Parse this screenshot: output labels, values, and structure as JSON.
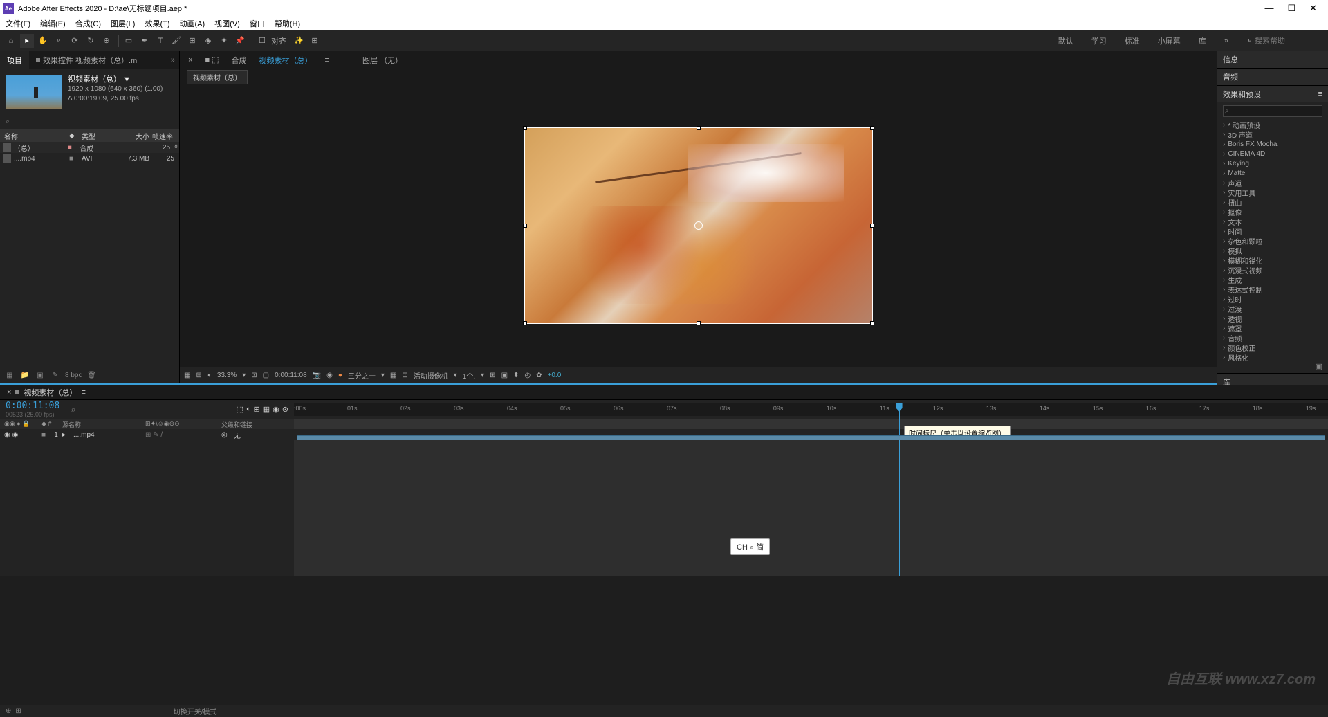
{
  "titlebar": {
    "app": "Adobe After Effects 2020",
    "path": "D:\\ae\\无标题项目.aep *"
  },
  "menu": [
    "文件(F)",
    "编辑(E)",
    "合成(C)",
    "图层(L)",
    "效果(T)",
    "动画(A)",
    "视图(V)",
    "窗口",
    "帮助(H)"
  ],
  "toolbar": {
    "snap": "对齐",
    "workspaces": [
      "默认",
      "学习",
      "标准",
      "小屏幕",
      "库"
    ],
    "search_placeholder": "搜索帮助"
  },
  "project": {
    "tab1": "项目",
    "tab2": "效果控件 视频素材（总）.m",
    "title": "视频素材（总） ▼",
    "res": "1920 x 1080 (640 x 360) (1.00)",
    "dur": "Δ 0:00:19:09, 25.00 fps",
    "search_placeholder": "⌕",
    "headers": {
      "name": "名称",
      "type": "类型",
      "size": "大小",
      "fps": "帧速率"
    },
    "rows": [
      {
        "name": "（总）",
        "type": "合成",
        "size": "",
        "fps": "25"
      },
      {
        "name": "....mp4",
        "type": "AVI",
        "size": "7.3 MB",
        "fps": "25"
      }
    ],
    "bpc": "8 bpc"
  },
  "composition": {
    "prefix": "合成",
    "name": "视频素材（总）",
    "layer_tab": "图层 （无）",
    "subtab": "视频素材（总）"
  },
  "viewer_footer": {
    "zoom": "33.3%",
    "time": "0:00:11:08",
    "res": "三分之一",
    "camera": "活动摄像机",
    "views": "1个.",
    "exposure": "+0.0"
  },
  "right_panel": {
    "info": "信息",
    "audio": "音频",
    "effects": "效果和预设",
    "search_placeholder": "⌕",
    "categories": [
      "* 动画预设",
      "3D 声道",
      "Boris FX Mocha",
      "CINEMA 4D",
      "Keying",
      "Matte",
      "声道",
      "实用工具",
      "扭曲",
      "抠像",
      "文本",
      "时间",
      "杂色和颗粒",
      "模拟",
      "模糊和锐化",
      "沉浸式视频",
      "生成",
      "表达式控制",
      "过时",
      "过渡",
      "透视",
      "遮罩",
      "音频",
      "颜色校正",
      "风格化"
    ],
    "library": "库"
  },
  "timeline": {
    "tab": "视频素材（总）",
    "time": "0:00:11:08",
    "fps": "00523 (25.00 fps)",
    "col_source": "源名称",
    "col_parent": "父级和链接",
    "layer_name": "....mp4",
    "layer_idx": "1",
    "parent_none": "无",
    "marks": [
      ":00s",
      "01s",
      "02s",
      "03s",
      "04s",
      "05s",
      "06s",
      "07s",
      "08s",
      "09s",
      "10s",
      "11s",
      "12s",
      "13s",
      "14s",
      "15s",
      "16s",
      "17s",
      "18s",
      "19s"
    ],
    "tooltip": "时间标尺（单击以设置缩览图）",
    "ime": "CH ⌕ 简"
  },
  "footer": {
    "switches": "切换开关/模式"
  },
  "watermark": "自由互联\nwww.xz7.com"
}
